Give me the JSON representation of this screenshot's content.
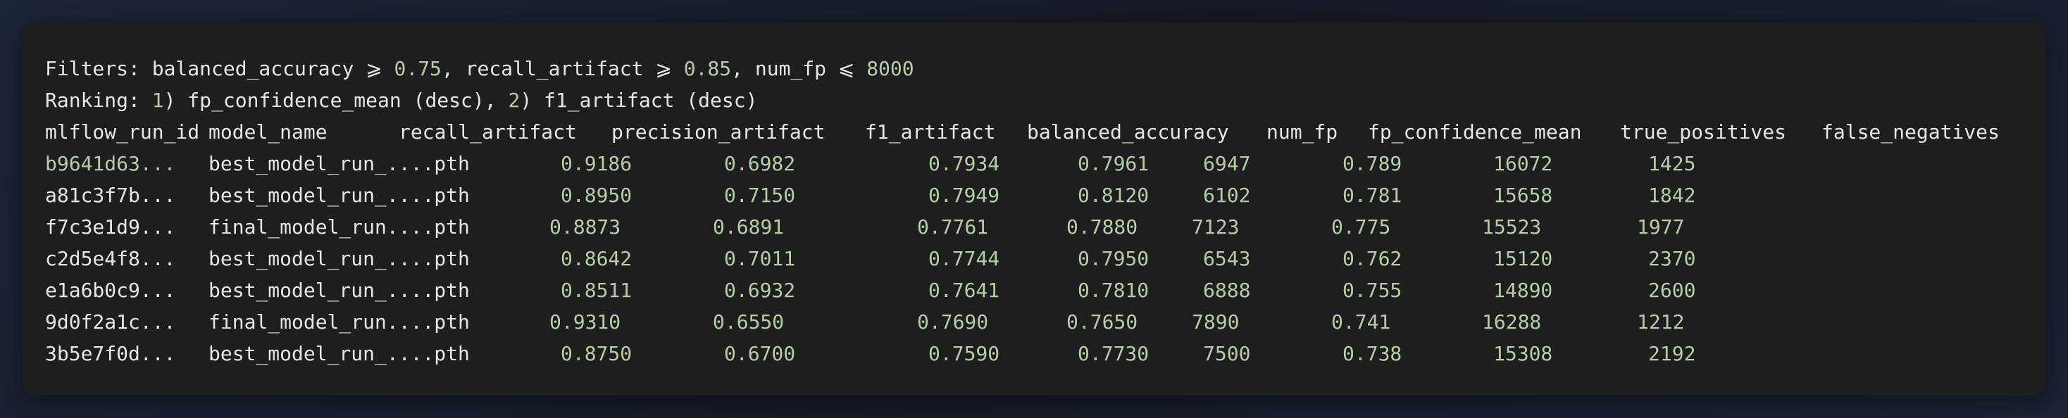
{
  "filters": {
    "label": "Filters: ",
    "parts": [
      {
        "name": "balanced_accuracy",
        "op": "⩾",
        "value": "0.75"
      },
      {
        "name": "recall_artifact",
        "op": "⩾",
        "value": "0.85"
      },
      {
        "name": "num_fp",
        "op": "⩽",
        "value": "8000"
      }
    ]
  },
  "ranking": {
    "label": "Ranking: ",
    "items": [
      {
        "index": "1",
        "text": "fp_confidence_mean (desc)"
      },
      {
        "index": "2",
        "text": "f1_artifact (desc)"
      }
    ]
  },
  "table": {
    "columns": [
      "mlflow_run_id",
      "model_name",
      "recall_artifact",
      "precision_artifact",
      "f1_artifact",
      "balanced_accuracy",
      "num_fp",
      "fp_confidence_mean",
      "true_positives",
      "false_negatives"
    ],
    "rows": [
      {
        "run_id": "b9641d63...",
        "model_name": "best_model_run_....pth",
        "recall": "0.9186",
        "precision": "0.6982",
        "f1": "0.7934",
        "bal_acc": "0.7961",
        "num_fp": "6947",
        "fp_conf": "0.789",
        "tp": "16072",
        "fn": "1425"
      },
      {
        "run_id": "a81c3f7b...",
        "model_name": "best_model_run_....pth",
        "recall": "0.8950",
        "precision": "0.7150",
        "f1": "0.7949",
        "bal_acc": "0.8120",
        "num_fp": "6102",
        "fp_conf": "0.781",
        "tp": "15658",
        "fn": "1842"
      },
      {
        "run_id": "f7c3e1d9...",
        "model_name": "final_model_run....pth",
        "recall": "0.8873",
        "precision": "0.6891",
        "f1": "0.7761",
        "bal_acc": "0.7880",
        "num_fp": "7123",
        "fp_conf": "0.775",
        "tp": "15523",
        "fn": "1977"
      },
      {
        "run_id": "c2d5e4f8...",
        "model_name": "best_model_run_....pth",
        "recall": "0.8642",
        "precision": "0.7011",
        "f1": "0.7744",
        "bal_acc": "0.7950",
        "num_fp": "6543",
        "fp_conf": "0.762",
        "tp": "15120",
        "fn": "2370"
      },
      {
        "run_id": "e1a6b0c9...",
        "model_name": "best_model_run_....pth",
        "recall": "0.8511",
        "precision": "0.6932",
        "f1": "0.7641",
        "bal_acc": "0.7810",
        "num_fp": "6888",
        "fp_conf": "0.755",
        "tp": "14890",
        "fn": "2600"
      },
      {
        "run_id": "9d0f2a1c...",
        "model_name": "final_model_run....pth",
        "recall": "0.9310",
        "precision": "0.6550",
        "f1": "0.7690",
        "bal_acc": "0.7650",
        "num_fp": "7890",
        "fp_conf": "0.741",
        "tp": "16288",
        "fn": "1212"
      },
      {
        "run_id": "3b5e7f0d...",
        "model_name": "best_model_run_....pth",
        "recall": "0.8750",
        "precision": "0.6700",
        "f1": "0.7590",
        "bal_acc": "0.7730",
        "num_fp": "7500",
        "fp_conf": "0.738",
        "tp": "15308",
        "fn": "2192"
      }
    ]
  },
  "colors": {
    "background": "#1e1e1e",
    "text": "#e6e6e6",
    "number": "#b5cea8"
  }
}
